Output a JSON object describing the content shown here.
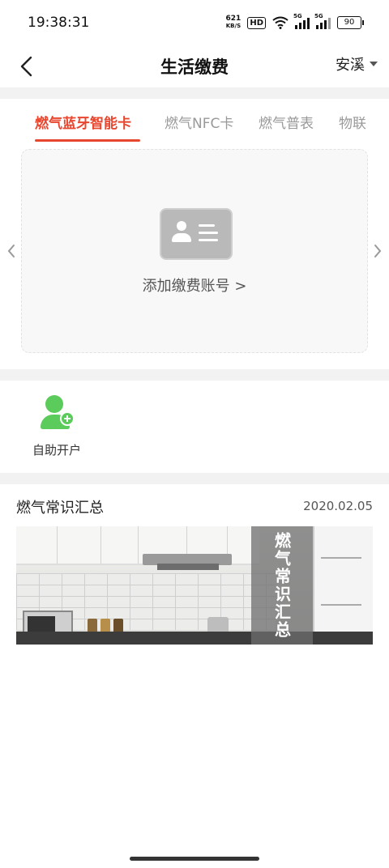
{
  "status_bar": {
    "time": "19:38:31",
    "net_speed_value": "621",
    "net_speed_unit": "KB/S",
    "hd_label": "HD",
    "sim1_label": "5G",
    "sim2_label": "5G",
    "battery": "90"
  },
  "header": {
    "title": "生活缴费",
    "city": "安溪"
  },
  "tabs": [
    {
      "label": "燃气蓝牙智能卡",
      "active": true
    },
    {
      "label": "燃气NFC卡",
      "active": false
    },
    {
      "label": "燃气普表",
      "active": false
    },
    {
      "label": "物联",
      "active": false
    }
  ],
  "card_panel": {
    "add_account_label": "添加缴费账号 >"
  },
  "services": {
    "self_open_label": "自助开户"
  },
  "news": {
    "title": "燃气常识汇总",
    "date": "2020.02.05",
    "banner_text": "燃气常识汇总"
  },
  "colors": {
    "accent": "#e8472f",
    "service_green": "#5bcb5b"
  }
}
